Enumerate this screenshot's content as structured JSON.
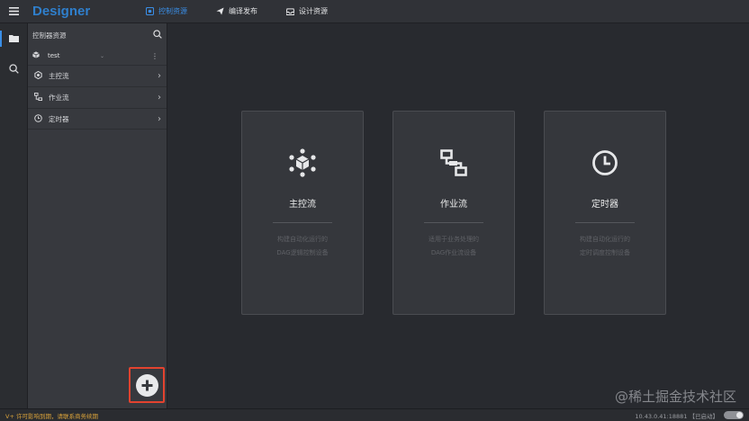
{
  "app": {
    "brand": "Designer"
  },
  "topnav": [
    {
      "label": "控制资源",
      "icon": "control-icon",
      "active": true
    },
    {
      "label": "编译发布",
      "icon": "send-icon",
      "active": false
    },
    {
      "label": "设计资源",
      "icon": "inbox-icon",
      "active": false
    }
  ],
  "panel": {
    "title": "控制器资源",
    "project": {
      "name": "test"
    },
    "sections": [
      {
        "label": "主控流",
        "icon": "hexagon-cube-icon"
      },
      {
        "label": "作业流",
        "icon": "flow-icon"
      },
      {
        "label": "定时器",
        "icon": "clock-icon"
      }
    ]
  },
  "cards": [
    {
      "title": "主控流",
      "desc_line1": "构建自动化运行的",
      "desc_line2": "DAG逻辑控制设备",
      "icon": "hexagon-cube-icon"
    },
    {
      "title": "作业流",
      "desc_line1": "适用于业务处理的",
      "desc_line2": "DAG作业流设备",
      "icon": "flow-icon"
    },
    {
      "title": "定时器",
      "desc_line1": "构建自动化运行的",
      "desc_line2": "定时调度控制设备",
      "icon": "clock-icon"
    }
  ],
  "watermark": "@稀土掘金技术社区",
  "status": {
    "left": "V+ 许可影响到期，请联系商务续期",
    "right": "10.43.0.41:18881 【已启动】"
  },
  "colors": {
    "accent": "#3a8ee6",
    "highlight": "#e3432f",
    "warning": "#d9a23a"
  }
}
